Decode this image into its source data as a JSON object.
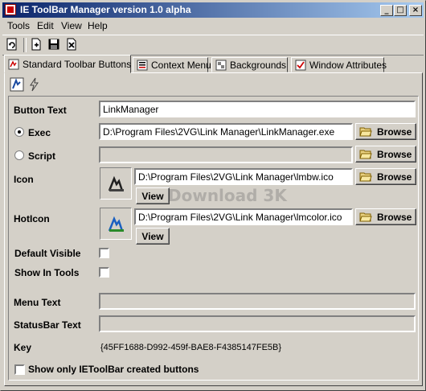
{
  "window": {
    "title": "IE ToolBar Manager version 1.0 alpha",
    "controls": [
      "_",
      "□",
      "×"
    ]
  },
  "menu": [
    "Tools",
    "Edit",
    "View",
    "Help"
  ],
  "tabs": [
    "Standard Toolbar Buttons",
    "Context Menu",
    "Backgrounds",
    "Window Attributes"
  ],
  "form": {
    "button_text_label": "Button Text",
    "button_text_value": "LinkManager",
    "exec_label": "Exec",
    "exec_value": "D:\\Program Files\\2VG\\Link Manager\\LinkManager.exe",
    "script_label": "Script",
    "script_value": "",
    "browse_label": "Browse",
    "icon_label": "Icon",
    "icon_value": "D:\\Program Files\\2VG\\Link Manager\\lmbw.ico",
    "view_label": "View",
    "hoticon_label": "HotIcon",
    "hoticon_value": "D:\\Program Files\\2VG\\Link Manager\\lmcolor.ico",
    "default_visible_label": "Default Visible",
    "show_in_tools_label": "Show In Tools",
    "menu_text_label": "Menu Text",
    "statusbar_text_label": "StatusBar Text",
    "key_label": "Key",
    "key_value": "{45FF1688-D992-459f-BAE8-F4385147FE5B}",
    "show_only_label": "Show only IEToolBar created buttons"
  },
  "watermark": "Download 3K",
  "colors": {
    "title_start": "#0a246a",
    "title_end": "#a6caf0",
    "face": "#d4d0c8"
  }
}
